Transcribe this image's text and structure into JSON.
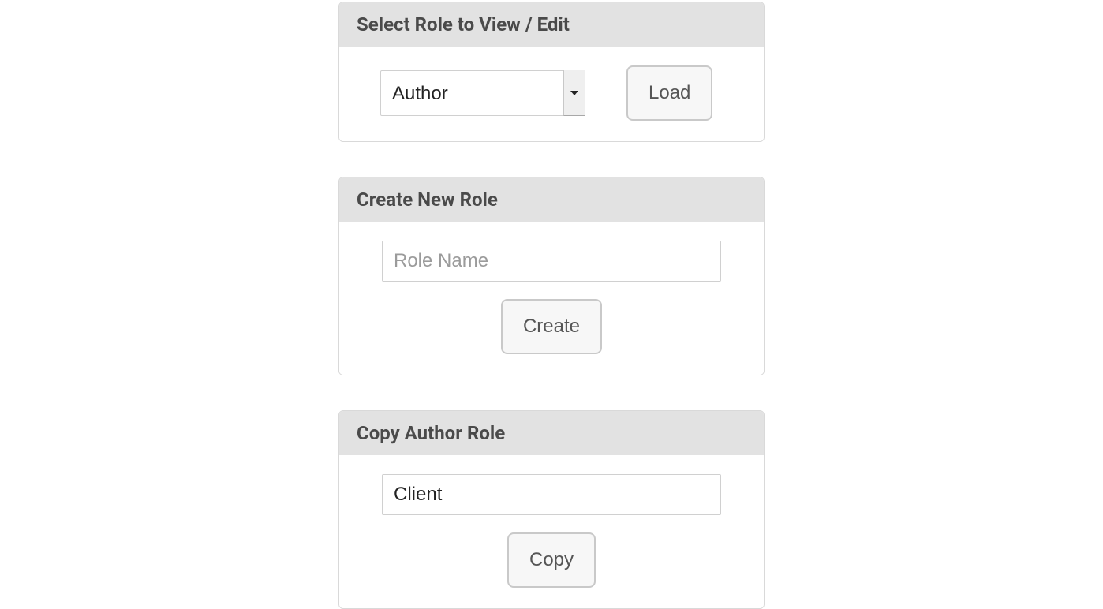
{
  "select_panel": {
    "title": "Select Role to View / Edit",
    "selected_role": "Author",
    "load_label": "Load"
  },
  "create_panel": {
    "title": "Create New Role",
    "placeholder": "Role Name",
    "value": "",
    "create_label": "Create"
  },
  "copy_panel": {
    "title": "Copy Author Role",
    "value": "Client",
    "copy_label": "Copy"
  }
}
